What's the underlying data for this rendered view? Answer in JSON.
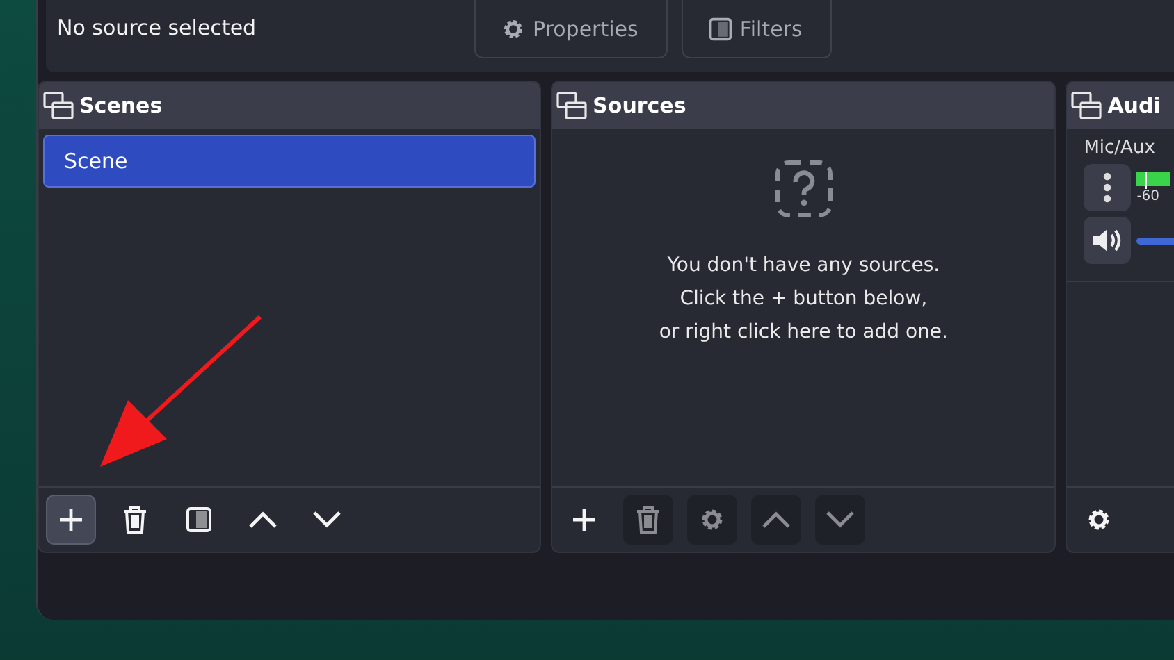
{
  "context_bar": {
    "status": "No source selected",
    "buttons": [
      {
        "kind": "properties",
        "label": "Properties"
      },
      {
        "kind": "filters",
        "label": "Filters"
      }
    ]
  },
  "docks": [
    {
      "kind": "scenes",
      "title": "Scenes",
      "items": [
        {
          "label": "Scene",
          "selected": true
        }
      ],
      "toolbar": [
        {
          "kind": "add",
          "disabled": false,
          "highlighted": true
        },
        {
          "kind": "remove",
          "disabled": false,
          "highlighted": false
        },
        {
          "kind": "filters",
          "disabled": false,
          "highlighted": false
        },
        {
          "kind": "up",
          "disabled": false,
          "highlighted": false
        },
        {
          "kind": "down",
          "disabled": false,
          "highlighted": false
        }
      ]
    },
    {
      "kind": "sources",
      "title": "Sources",
      "empty_message": [
        "You don't have any sources.",
        "Click the + button below,",
        "or right click here to add one."
      ],
      "toolbar": [
        {
          "kind": "add",
          "disabled": false,
          "highlighted": false
        },
        {
          "kind": "remove",
          "disabled": true,
          "highlighted": false
        },
        {
          "kind": "settings",
          "disabled": true,
          "highlighted": false
        },
        {
          "kind": "up",
          "disabled": true,
          "highlighted": false
        },
        {
          "kind": "down",
          "disabled": true,
          "highlighted": false
        }
      ]
    },
    {
      "kind": "mixer",
      "title": "Audi",
      "channel": {
        "name": "Mic/Aux",
        "tick": "-60"
      },
      "toolbar": [
        {
          "kind": "settings",
          "disabled": false,
          "highlighted": false
        }
      ]
    }
  ]
}
